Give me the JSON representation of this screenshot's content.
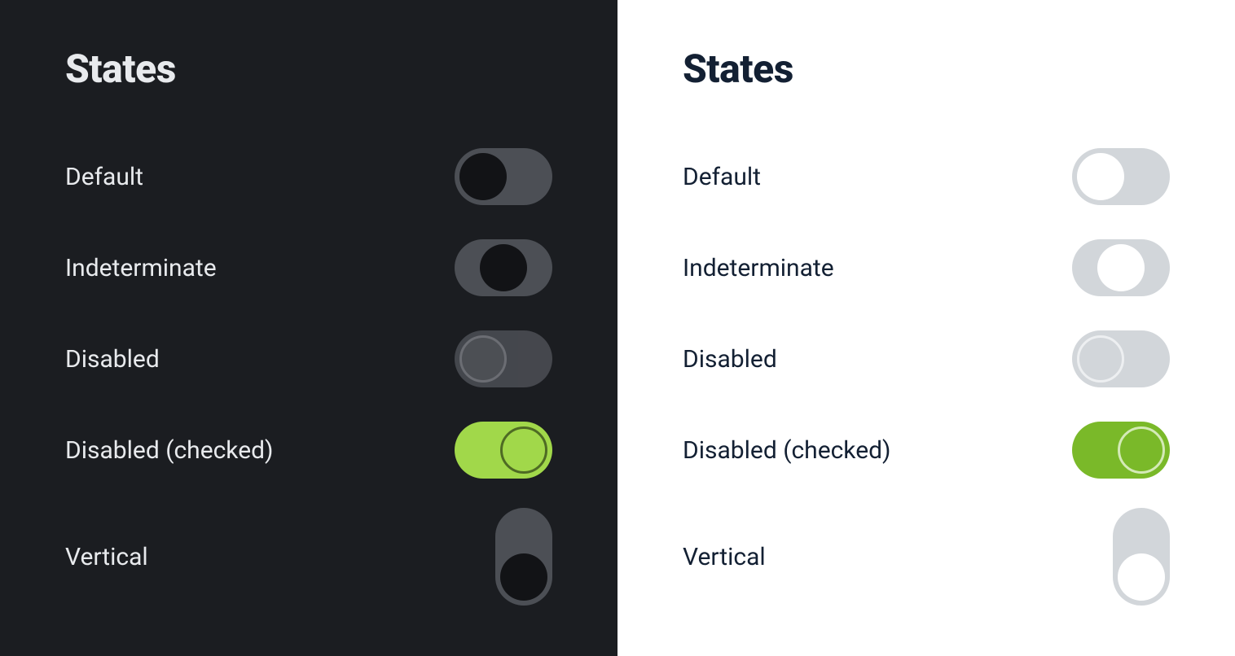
{
  "dark": {
    "heading": "States",
    "rows": [
      {
        "label": "Default"
      },
      {
        "label": "Indeterminate"
      },
      {
        "label": "Disabled"
      },
      {
        "label": "Disabled (checked)"
      },
      {
        "label": "Vertical"
      }
    ]
  },
  "light": {
    "heading": "States",
    "rows": [
      {
        "label": "Default"
      },
      {
        "label": "Indeterminate"
      },
      {
        "label": "Disabled"
      },
      {
        "label": "Disabled (checked)"
      },
      {
        "label": "Vertical"
      }
    ]
  },
  "colors": {
    "dark_bg": "#1b1d21",
    "light_bg": "#ffffff",
    "accent_dark": "#a1d84a",
    "accent_light": "#7ab929"
  }
}
